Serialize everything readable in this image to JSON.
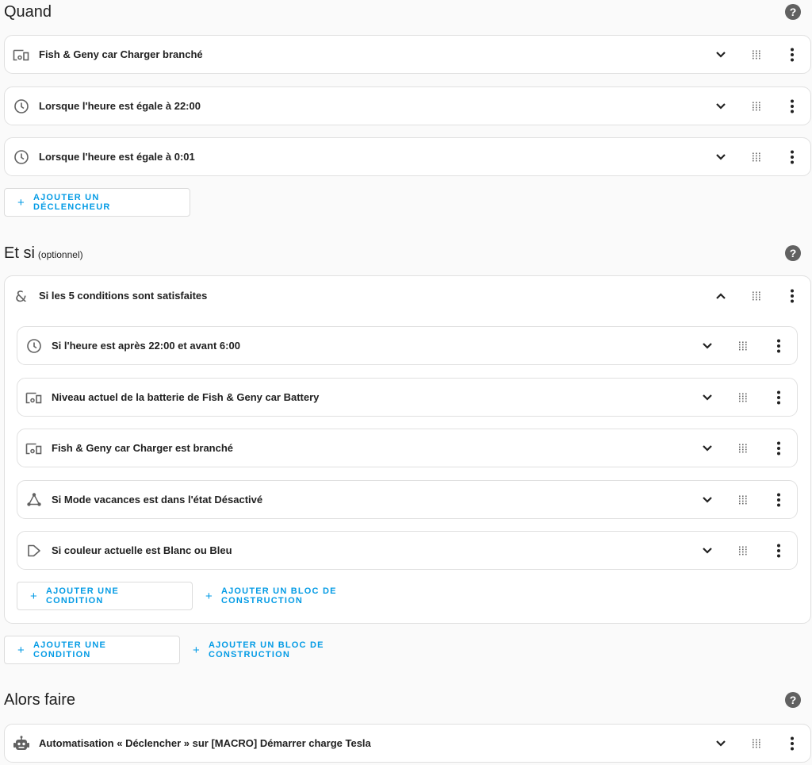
{
  "triggers": {
    "title": "Quand",
    "items": [
      {
        "icon": "device-icon",
        "label": "Fish & Geny car Charger branché"
      },
      {
        "icon": "clock-icon",
        "label": "Lorsque l'heure est égale à 22:00"
      },
      {
        "icon": "clock-icon",
        "label": "Lorsque l'heure est égale à 0:01"
      }
    ],
    "add_button": "AJOUTER UN DÉCLENCHEUR"
  },
  "conditions": {
    "title": "Et si",
    "optional": "(optionnel)",
    "group": {
      "icon": "ampersand-icon",
      "label": "Si les 5 conditions sont satisfaites",
      "items": [
        {
          "icon": "clock-icon",
          "label": "Si l'heure est après 22:00 et avant 6:00"
        },
        {
          "icon": "device-icon",
          "label": "Niveau actuel de la batterie de Fish & Geny car Battery"
        },
        {
          "icon": "device-icon",
          "label": "Fish & Geny car Charger est branché"
        },
        {
          "icon": "state-icon",
          "label": "Si Mode vacances est dans l'état Désactivé"
        },
        {
          "icon": "template-icon",
          "label": "Si couleur actuelle est Blanc ou Bleu"
        }
      ],
      "add_condition": "AJOUTER UNE CONDITION",
      "add_block": "AJOUTER UN BLOC DE CONSTRUCTION"
    },
    "add_condition": "AJOUTER UNE CONDITION",
    "add_block": "AJOUTER UN BLOC DE CONSTRUCTION"
  },
  "actions": {
    "title": "Alors faire",
    "items": [
      {
        "icon": "robot-icon",
        "label": "Automatisation « Déclencher » sur [MACRO] Démarrer charge Tesla"
      }
    ]
  },
  "help_glyph": "?"
}
